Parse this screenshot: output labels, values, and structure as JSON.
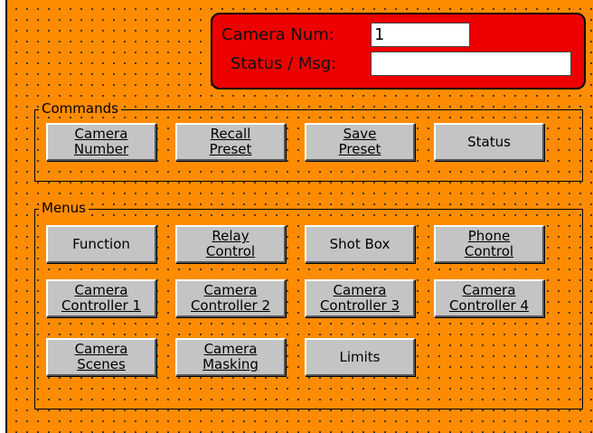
{
  "camera_panel": {
    "camera_num_label": "Camera Num:",
    "camera_num_value": "1",
    "status_label": "Status / Msg:",
    "status_value": ""
  },
  "commands": {
    "title": "Commands",
    "buttons": [
      {
        "label": "Camera\nNumber"
      },
      {
        "label": "Recall\nPreset"
      },
      {
        "label": "Save\nPreset"
      },
      {
        "label": "Status"
      }
    ]
  },
  "menus": {
    "title": "Menus",
    "buttons": [
      {
        "label": "Function"
      },
      {
        "label": "Relay\nControl"
      },
      {
        "label": "Shot Box"
      },
      {
        "label": "Phone\nControl"
      },
      {
        "label": "Camera\nController 1"
      },
      {
        "label": "Camera\nController 2"
      },
      {
        "label": "Camera\nController 3"
      },
      {
        "label": "Camera\nController 4"
      },
      {
        "label": "Camera\nScenes"
      },
      {
        "label": "Camera\nMasking"
      },
      {
        "label": "Limits"
      }
    ]
  },
  "colors": {
    "form_background": "#ff8c00",
    "panel_background": "#ee0000",
    "button_face": "#c4c4c4"
  }
}
